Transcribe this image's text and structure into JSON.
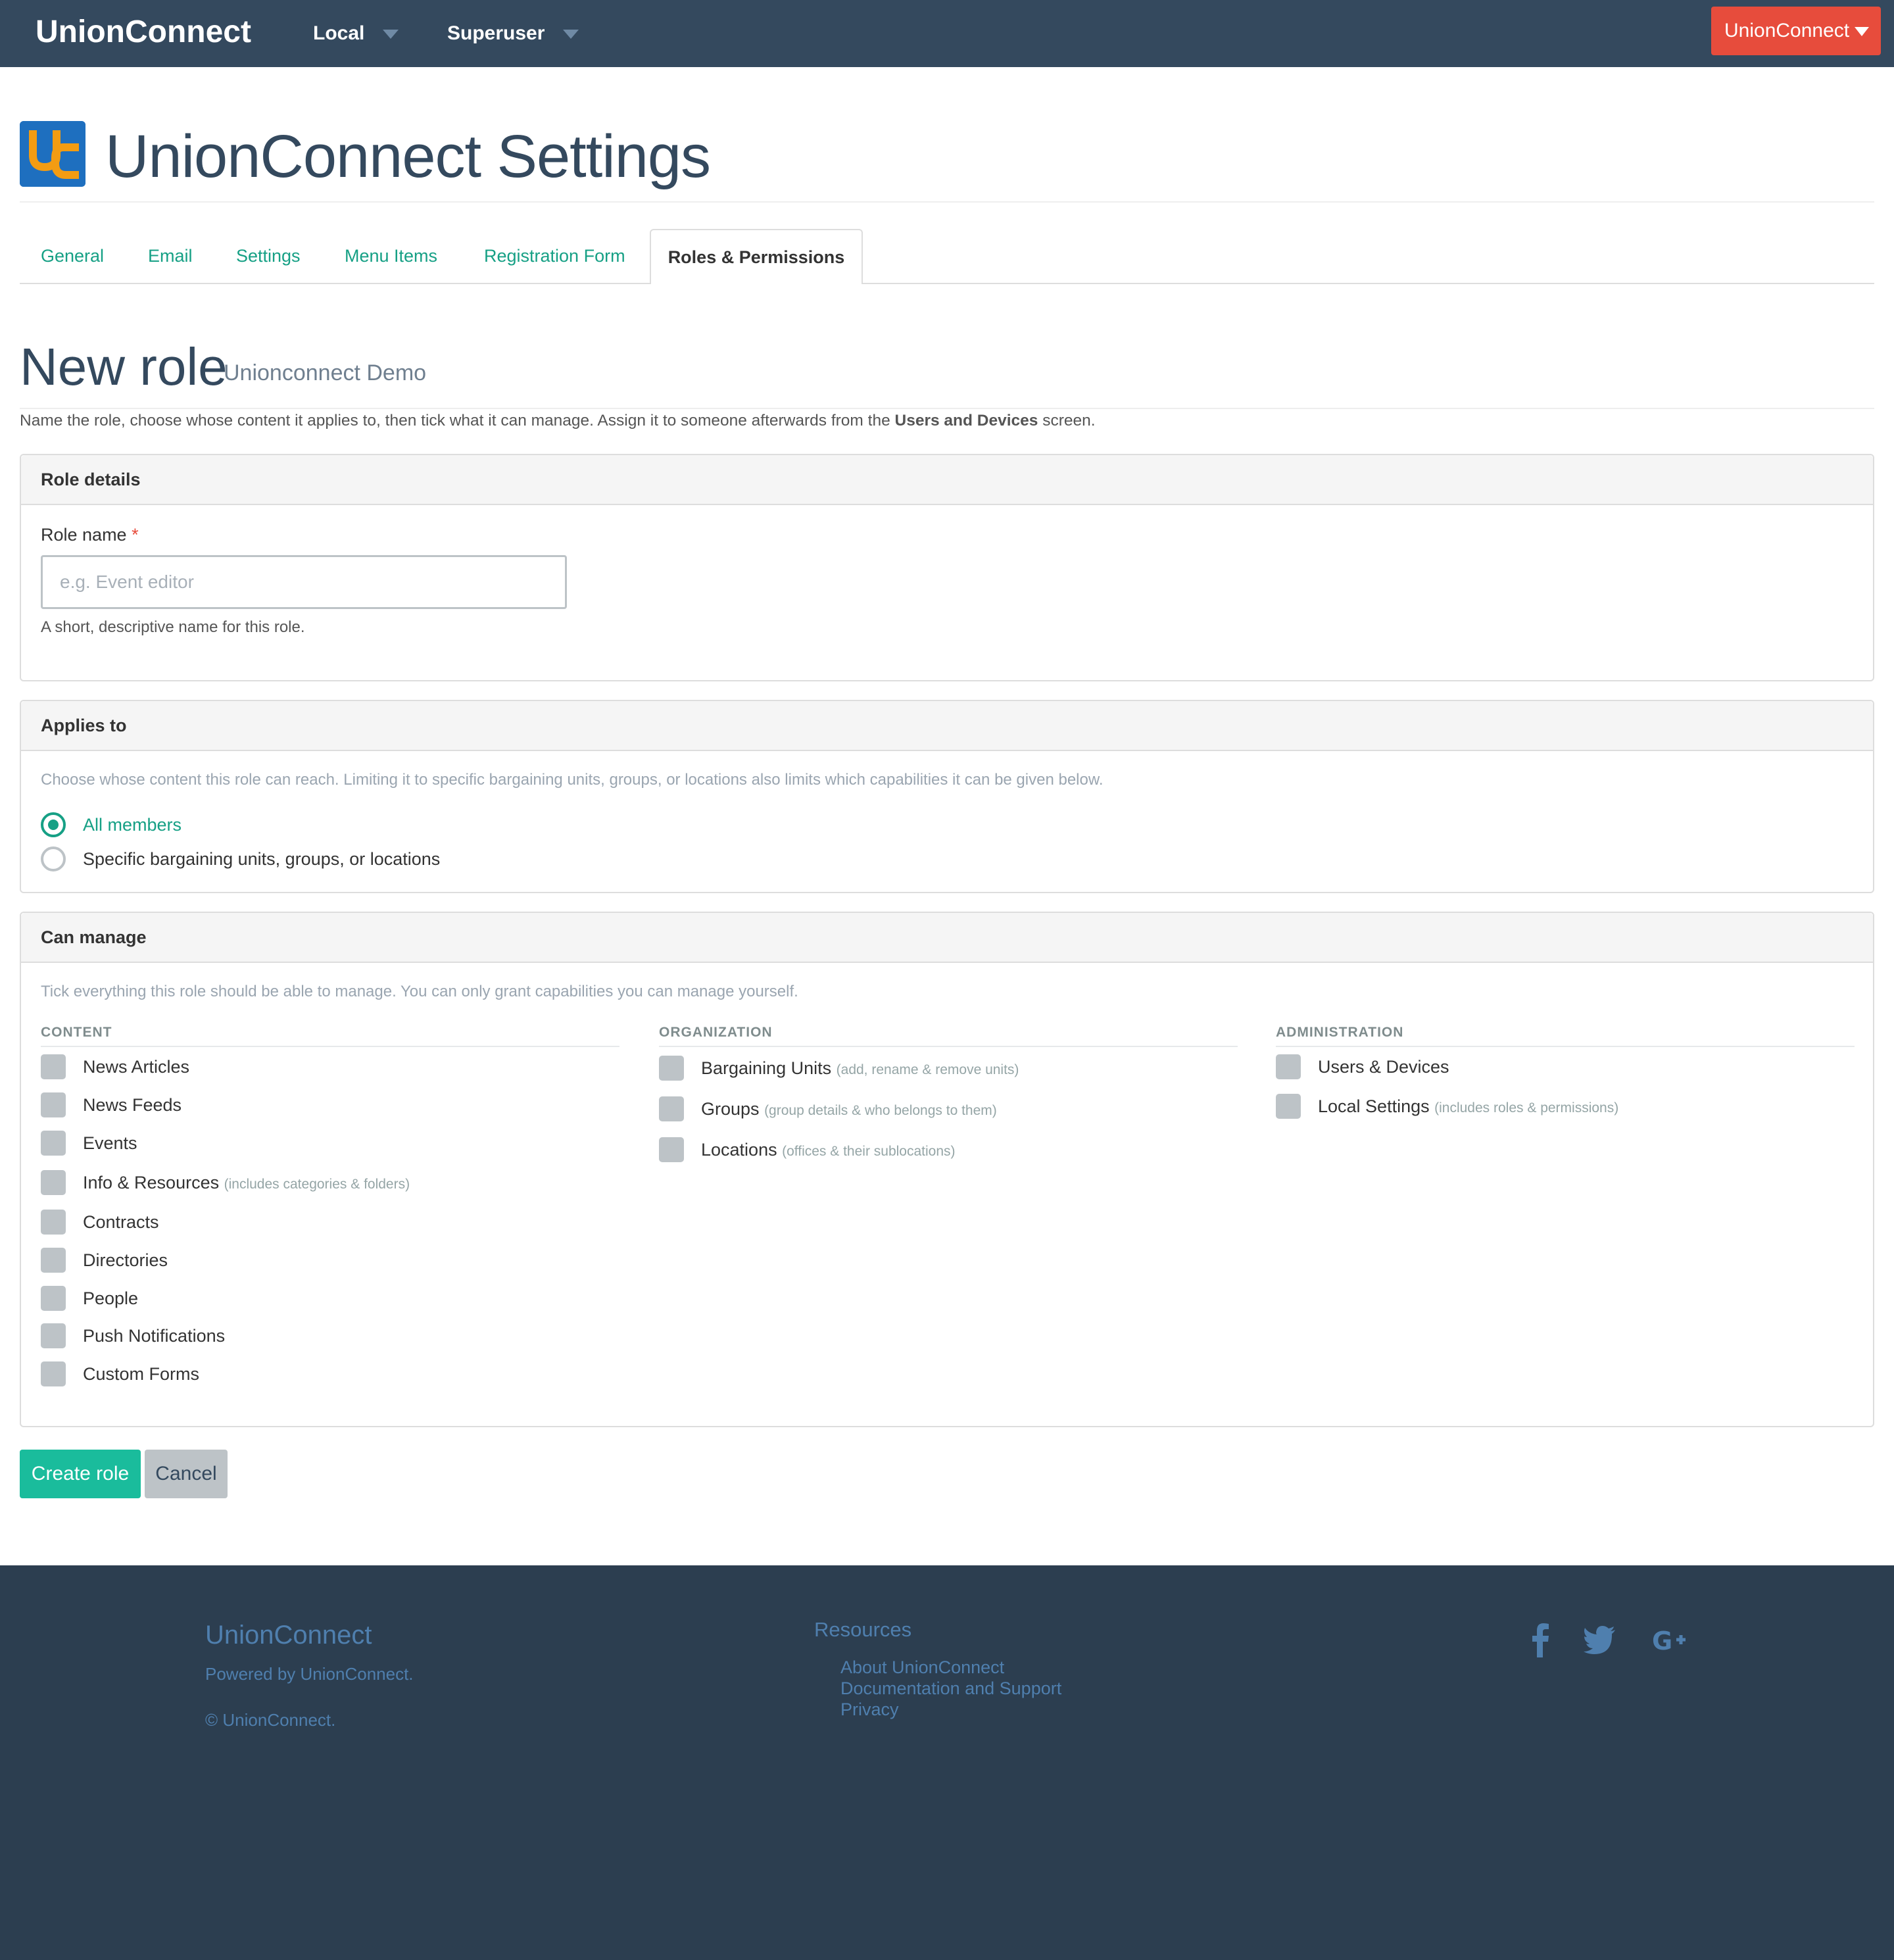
{
  "navbar": {
    "brand": "UnionConnect",
    "local_label": "Local",
    "user_label": "Superuser",
    "account_label": "UnionConnect"
  },
  "header": {
    "title": "UnionConnect Settings",
    "logo_icon": "uc-logo-icon"
  },
  "tabs": [
    {
      "label": "General"
    },
    {
      "label": "Email"
    },
    {
      "label": "Settings"
    },
    {
      "label": "Menu Items"
    },
    {
      "label": "Registration Form"
    },
    {
      "label": "Roles & Permissions",
      "active": true
    }
  ],
  "section": {
    "title": "New role",
    "subtitle": "Unionconnect Demo",
    "intro_before": "Name the role, choose whose content it applies to, then tick what it can manage. Assign it to someone afterwards from the ",
    "intro_bold": "Users and Devices",
    "intro_after": " screen."
  },
  "role_details": {
    "heading": "Role details",
    "label": "Role name",
    "required_mark": "*",
    "value": "",
    "placeholder": "e.g. Event editor",
    "hint": "A short, descriptive name for this role."
  },
  "applies_to": {
    "heading": "Applies to",
    "help": "Choose whose content this role can reach. Limiting it to specific bargaining units, groups, or locations also limits which capabilities it can be given below.",
    "options": [
      {
        "label": "All members",
        "selected": true
      },
      {
        "label": "Specific bargaining units, groups, or locations",
        "selected": false
      }
    ]
  },
  "can_manage": {
    "heading": "Can manage",
    "help": "Tick everything this role should be able to manage. You can only grant capabilities you can manage yourself.",
    "columns": [
      {
        "heading": "CONTENT",
        "items": [
          {
            "label": "News Articles",
            "note": ""
          },
          {
            "label": "News Feeds",
            "note": ""
          },
          {
            "label": "Events",
            "note": ""
          },
          {
            "label": "Info & Resources",
            "note": "(includes categories & folders)"
          },
          {
            "label": "Contracts",
            "note": ""
          },
          {
            "label": "Directories",
            "note": ""
          },
          {
            "label": "People",
            "note": ""
          },
          {
            "label": "Push Notifications",
            "note": ""
          },
          {
            "label": "Custom Forms",
            "note": ""
          }
        ]
      },
      {
        "heading": "ORGANIZATION",
        "items": [
          {
            "label": "Bargaining Units",
            "note": "(add, rename & remove units)"
          },
          {
            "label": "Groups",
            "note": "(group details & who belongs to them)"
          },
          {
            "label": "Locations",
            "note": "(offices & their sublocations)"
          }
        ]
      },
      {
        "heading": "ADMINISTRATION",
        "items": [
          {
            "label": "Users & Devices",
            "note": ""
          },
          {
            "label": "Local Settings",
            "note": "(includes roles & permissions)"
          }
        ]
      }
    ]
  },
  "actions": {
    "create_label": "Create role",
    "cancel_label": "Cancel"
  },
  "footer": {
    "brand": "UnionConnect",
    "powered": "Powered by UnionConnect.",
    "copyright": "© UnionConnect.",
    "resources_heading": "Resources",
    "links": [
      "About UnionConnect",
      "Documentation and Support",
      "Privacy"
    ],
    "social_icons": [
      "facebook-icon",
      "twitter-icon",
      "google-plus-icon"
    ]
  },
  "colors": {
    "navbar": "#34495e",
    "accent": "#16a085",
    "primary_button": "#1abc9c",
    "account_button": "#e74c3c",
    "footer": "#2c3e50"
  }
}
